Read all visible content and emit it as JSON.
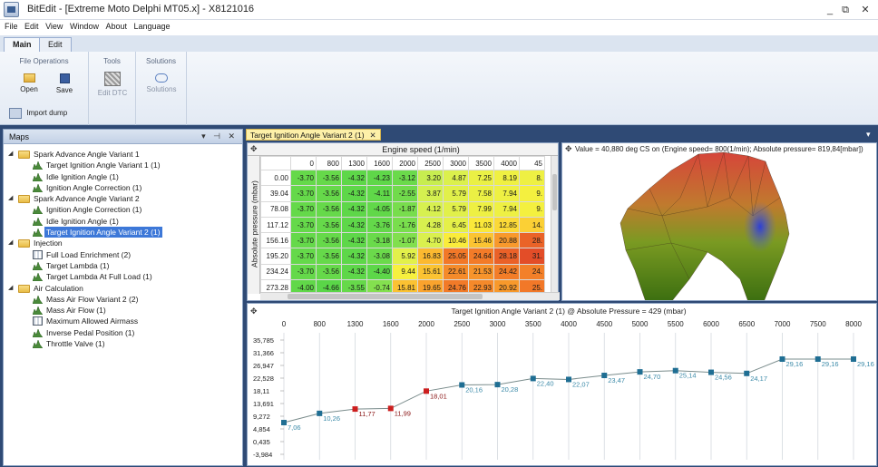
{
  "window": {
    "title": "BitEdit - [Extreme Moto Delphi MT05.x] - X8121016",
    "controls": [
      "_",
      "⧉",
      "✕"
    ]
  },
  "menu": [
    "File",
    "Edit",
    "View",
    "Window",
    "About",
    "Language"
  ],
  "ribbon": {
    "tabs": [
      "Main",
      "Edit"
    ],
    "groups": [
      {
        "title": "File Operations",
        "buttons": [
          "Open",
          "Save",
          "Import dump"
        ]
      },
      {
        "title": "Tools",
        "buttons": [
          "Edit DTC"
        ]
      },
      {
        "title": "Solutions",
        "buttons": [
          "Solutions"
        ]
      }
    ]
  },
  "maps_panel": {
    "title": "Maps",
    "tree": [
      {
        "label": "Spark Advance Angle Variant 1",
        "folder": true
      },
      {
        "label": "Target Ignition Angle Variant 1 (1)"
      },
      {
        "label": "Idle Ignition Angle (1)"
      },
      {
        "label": "Ignition Angle Correction (1)"
      },
      {
        "label": "Spark Advance Angle Variant 2",
        "folder": true
      },
      {
        "label": "Ignition Angle Correction (1)"
      },
      {
        "label": "Idle Ignition Angle (1)"
      },
      {
        "label": "Target Ignition Angle Variant 2 (1)",
        "selected": true
      },
      {
        "label": "Injection",
        "folder": true
      },
      {
        "label": "Full Load Enrichment (2)",
        "icon": "map2d"
      },
      {
        "label": "Target Lambda (1)"
      },
      {
        "label": "Target Lambda At Full Load (1)"
      },
      {
        "label": "Air Calculation",
        "folder": true
      },
      {
        "label": "Mass Air Flow Variant 2 (2)"
      },
      {
        "label": "Mass Air Flow (1)"
      },
      {
        "label": "Maximum Allowed Airmass",
        "icon": "map2d"
      },
      {
        "label": "Inverse Pedal Position (1)"
      },
      {
        "label": "Throttle Valve (1)"
      }
    ]
  },
  "document_tab": {
    "label": "Target Ignition Angle Variant 2 (1)",
    "close": "✕"
  },
  "grid": {
    "x_axis_title": "Engine speed (1/min)",
    "y_axis_title": "Absolute pressure (mbar)",
    "columns": [
      "0",
      "800",
      "1300",
      "1600",
      "2000",
      "2500",
      "3000",
      "3500",
      "4000",
      "45"
    ],
    "rows": [
      {
        "p": "0.00",
        "v": [
          "-3.70",
          "-3.56",
          "-4.32",
          "-4.23",
          "-3.12",
          "3.20",
          "4.87",
          "7.25",
          "8.19",
          "8."
        ]
      },
      {
        "p": "39.04",
        "v": [
          "-3.70",
          "-3.56",
          "-4.32",
          "-4.11",
          "-2.55",
          "3.87",
          "5.79",
          "7.58",
          "7.94",
          "9."
        ]
      },
      {
        "p": "78.08",
        "v": [
          "-3.70",
          "-3.56",
          "-4.32",
          "-4.05",
          "-1.87",
          "4.12",
          "5.79",
          "7.99",
          "7.94",
          "9."
        ]
      },
      {
        "p": "117.12",
        "v": [
          "-3.70",
          "-3.56",
          "-4.32",
          "-3.76",
          "-1.76",
          "4.28",
          "6.45",
          "11.03",
          "12.85",
          "14."
        ]
      },
      {
        "p": "156.16",
        "v": [
          "-3.70",
          "-3.56",
          "-4.32",
          "-3.18",
          "-1.07",
          "4.70",
          "10.46",
          "15.46",
          "20.88",
          "28."
        ]
      },
      {
        "p": "195.20",
        "v": [
          "-3.70",
          "-3.56",
          "-4.32",
          "-3.08",
          "5.92",
          "16.83",
          "25.05",
          "24.64",
          "28.18",
          "31."
        ]
      },
      {
        "p": "234.24",
        "v": [
          "-3.70",
          "-3.56",
          "-4.32",
          "-4.40",
          "9.44",
          "15.61",
          "22.61",
          "21.53",
          "24.42",
          "24."
        ]
      },
      {
        "p": "273.28",
        "v": [
          "-4.00",
          "-4.66",
          "-3.55",
          "-0.74",
          "15.81",
          "19.65",
          "24.76",
          "22.93",
          "20.92",
          "25."
        ]
      }
    ]
  },
  "view3d": {
    "info": "Value = 40,880 deg CS on (Engine speed= 800(1/min); Absolute pressure= 819,84[mbar])"
  },
  "chart_data": {
    "type": "line",
    "title": "Target Ignition Angle Variant 2 (1) @ Absolute Pressure = 429 (mbar)",
    "categories": [
      "0",
      "800",
      "1300",
      "1600",
      "2000",
      "2500",
      "3000",
      "3500",
      "4000",
      "4500",
      "5000",
      "5500",
      "6000",
      "6500",
      "7000",
      "7500",
      "8000"
    ],
    "values": [
      7.06,
      10.26,
      11.77,
      11.99,
      18.01,
      20.16,
      20.28,
      22.4,
      22.07,
      23.47,
      24.7,
      25.14,
      24.56,
      24.17,
      29.16,
      29.16,
      29.16
    ],
    "point_labels": [
      "7,06",
      "10,26",
      "11,77",
      "11,99",
      "18,01",
      "20,16",
      "20,28",
      "22,40",
      "22,07",
      "23,47",
      "24,70",
      "25,14",
      "24,56",
      "24,17",
      "29,16",
      "29,16",
      "29,16"
    ],
    "highlighted_points": [
      2,
      3,
      4
    ],
    "y_ticks": [
      "35,785",
      "31,366",
      "26,947",
      "22,528",
      "18,11",
      "13,691",
      "9,272",
      "4,854",
      "0,435",
      "-3,984"
    ],
    "ylim": [
      -3.984,
      35.785
    ],
    "colors": {
      "point": "#1f6e93",
      "highlight": "#cc1e1e",
      "line": "#7a8c8c",
      "label": "#3b8aa8"
    }
  }
}
